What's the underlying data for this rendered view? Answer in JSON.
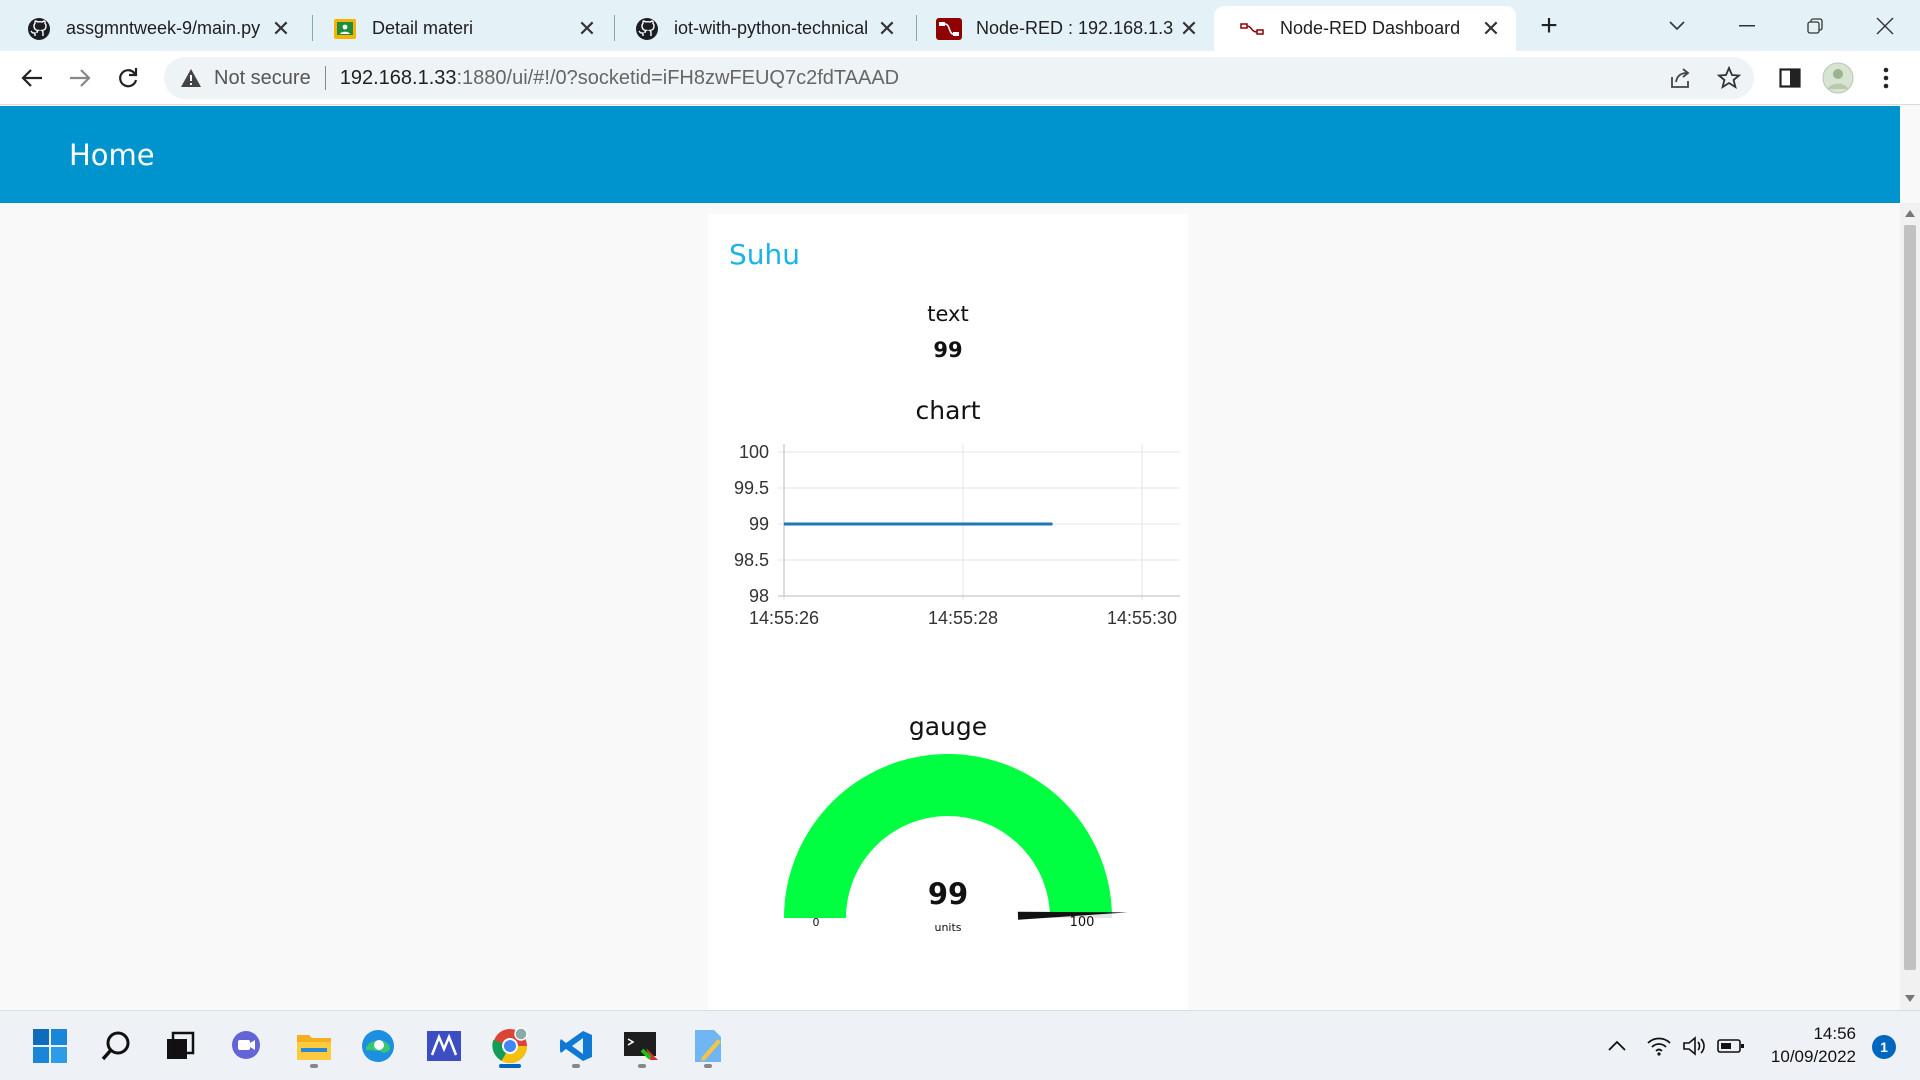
{
  "browser": {
    "tabs": [
      {
        "title": "assgmntweek-9/main.py",
        "icon": "github-icon",
        "active": false
      },
      {
        "title": "Detail materi",
        "icon": "classroom-icon",
        "active": false
      },
      {
        "title": "iot-with-python-technical",
        "icon": "github-icon",
        "active": false
      },
      {
        "title": "Node-RED : 192.168.1.33",
        "icon": "node-red-icon",
        "active": false
      },
      {
        "title": "Node-RED Dashboard",
        "icon": "node-red-icon",
        "active": true
      }
    ],
    "address": {
      "security_label": "Not secure",
      "host": "192.168.1.33",
      "path": ":1880/ui/#!/0?socketid=iFH8zwFEUQ7c2fdTAAAD"
    }
  },
  "dashboard": {
    "title": "Home",
    "group_title": "Suhu",
    "text_widget": {
      "label": "text",
      "value": "99"
    },
    "chart_widget": {
      "label": "chart"
    },
    "gauge_widget": {
      "label": "gauge",
      "value": "99",
      "units": "units",
      "min": "0",
      "max": "100",
      "fill_color": "#00ff41"
    }
  },
  "chart_data": {
    "type": "line",
    "title": "chart",
    "x_ticks": [
      "14:55:26",
      "14:55:28",
      "14:55:30"
    ],
    "y_ticks": [
      "98",
      "98.5",
      "99",
      "99.5",
      "100"
    ],
    "ylim": [
      98,
      100
    ],
    "series": [
      {
        "x": [
          "14:55:26",
          "14:55:29"
        ],
        "values": [
          99,
          99
        ],
        "color": "#1f77b4"
      }
    ],
    "grid": true
  },
  "taskbar": {
    "apps": [
      "windows-start-icon",
      "search-icon",
      "task-view-icon",
      "teams-chat-icon",
      "file-explorer-icon",
      "edge-icon",
      "mathcad-icon",
      "chrome-icon",
      "vscode-icon",
      "terminal-icon",
      "notepad-icon"
    ],
    "time": "14:56",
    "date": "10/09/2022",
    "notification_count": "1"
  }
}
